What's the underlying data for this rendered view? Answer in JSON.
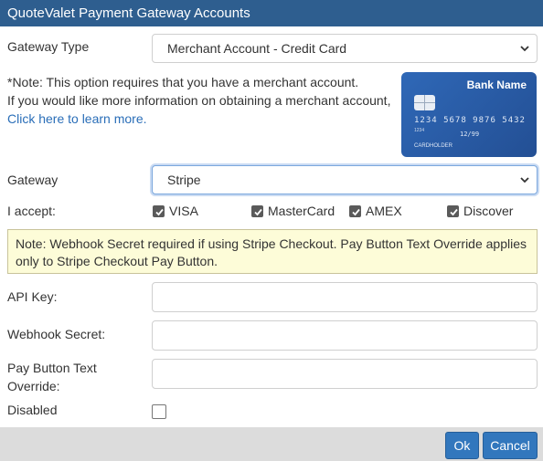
{
  "window": {
    "title": "QuoteValet Payment Gateway Accounts"
  },
  "gateway_type": {
    "label": "Gateway Type",
    "selected": "Merchant Account - Credit Card"
  },
  "note": {
    "line1": "*Note: This option requires that you have a merchant account.",
    "line2": "If you would like more information on obtaining a merchant account,",
    "link": "Click here to learn more."
  },
  "card_image": {
    "bank_name": "Bank Name",
    "number": "1234 5678 9876 5432",
    "small": "1234",
    "valid": "12/99",
    "holder": "CARDHOLDER"
  },
  "gateway": {
    "label": "Gateway",
    "selected": "Stripe"
  },
  "accept": {
    "label": "I accept:",
    "options": [
      {
        "label": "VISA",
        "checked": true
      },
      {
        "label": "MasterCard",
        "checked": true
      },
      {
        "label": "AMEX",
        "checked": true
      },
      {
        "label": "Discover",
        "checked": true
      }
    ]
  },
  "warning": {
    "text": "Note: Webhook Secret required if using Stripe Checkout. Pay Button Text Override applies only to Stripe Checkout Pay Button."
  },
  "fields": {
    "api_key": {
      "label": "API Key:",
      "value": ""
    },
    "webhook_secret": {
      "label": "Webhook Secret:",
      "value": ""
    },
    "pay_button_override": {
      "label_line1": "Pay Button Text",
      "label_line2": "Override:",
      "value": ""
    }
  },
  "disabled": {
    "label": "Disabled",
    "checked": false
  },
  "buttons": {
    "ok": "Ok",
    "cancel": "Cancel"
  },
  "colors": {
    "titlebar": "#2e5e8f",
    "button": "#3277bd",
    "warning_bg": "#fdfcd8",
    "link": "#2a6eb8"
  }
}
